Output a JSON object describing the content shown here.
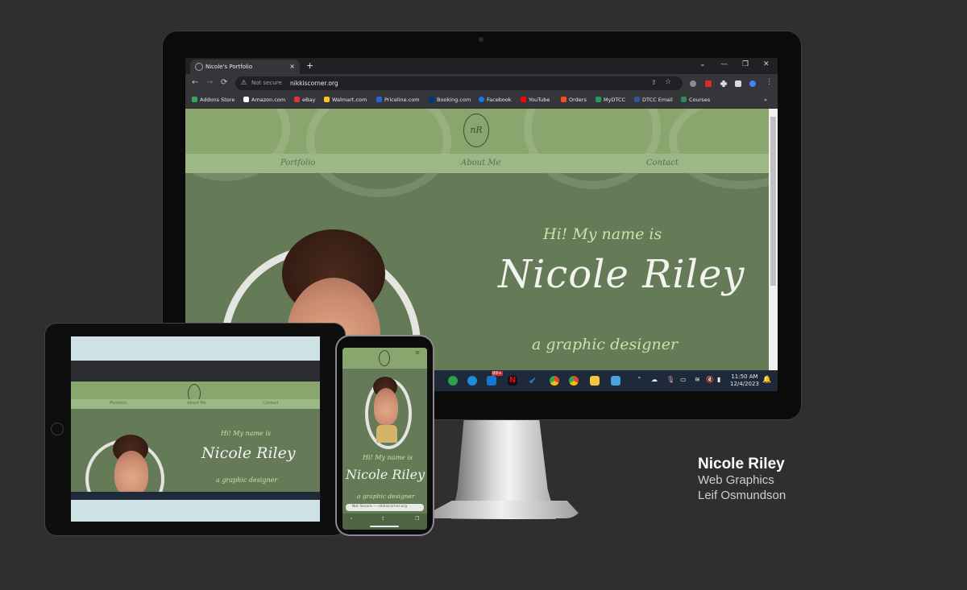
{
  "browser": {
    "tab_title": "Nicole's Portfolio",
    "tab_close": "×",
    "new_tab": "+",
    "window_controls": [
      "⌄",
      "—",
      "❐",
      "✕"
    ],
    "security_text": "Not secure",
    "url": "nikkiscorner.org",
    "bookmarks": [
      {
        "label": "Addons Store",
        "color": "#34a853"
      },
      {
        "label": "Amazon.com",
        "color": "#ffffff"
      },
      {
        "label": "eBay",
        "color": "#e53238"
      },
      {
        "label": "Walmart.com",
        "color": "#ffc220"
      },
      {
        "label": "Priceline.com",
        "color": "#2a63d8"
      },
      {
        "label": "Booking.com",
        "color": "#003580"
      },
      {
        "label": "Facebook",
        "color": "#1877f2"
      },
      {
        "label": "YouTube",
        "color": "#ff0000"
      },
      {
        "label": "Orders",
        "color": "#f25022"
      },
      {
        "label": "MyDTCC",
        "color": "#1e9e5e"
      },
      {
        "label": "DTCC Email",
        "color": "#2b579a"
      },
      {
        "label": "Courses",
        "color": "#2e8b57"
      }
    ],
    "bookmarks_more": "»"
  },
  "site": {
    "logo_text": "nR",
    "nav": [
      "Portfolio",
      "About Me",
      "Contact"
    ],
    "greeting": "Hi! My name is",
    "name": "Nicole Riley",
    "tagline": "a graphic designer"
  },
  "taskbar": {
    "time": "11:50 AM",
    "date": "12/4/2023",
    "mail_badge": "99+"
  },
  "tablet": {
    "greeting": "Hi! My name is",
    "name": "Nicole Riley",
    "tagline": "a graphic designer",
    "nav": [
      "Portfolio",
      "About Me",
      "Contact"
    ]
  },
  "phone": {
    "greeting": "Hi! My name is",
    "name": "Nicole Riley",
    "tagline": "a graphic designer",
    "url_bar": "Not Secure — nikkiscorner.org"
  },
  "caption": {
    "title": "Nicole Riley",
    "course": "Web Graphics",
    "instructor": "Leif Osmundson"
  },
  "colors": {
    "background": "#2f2f31",
    "site_green": "#657b58",
    "header_green": "#8aa66f",
    "accent_green": "#c9e3a8"
  }
}
